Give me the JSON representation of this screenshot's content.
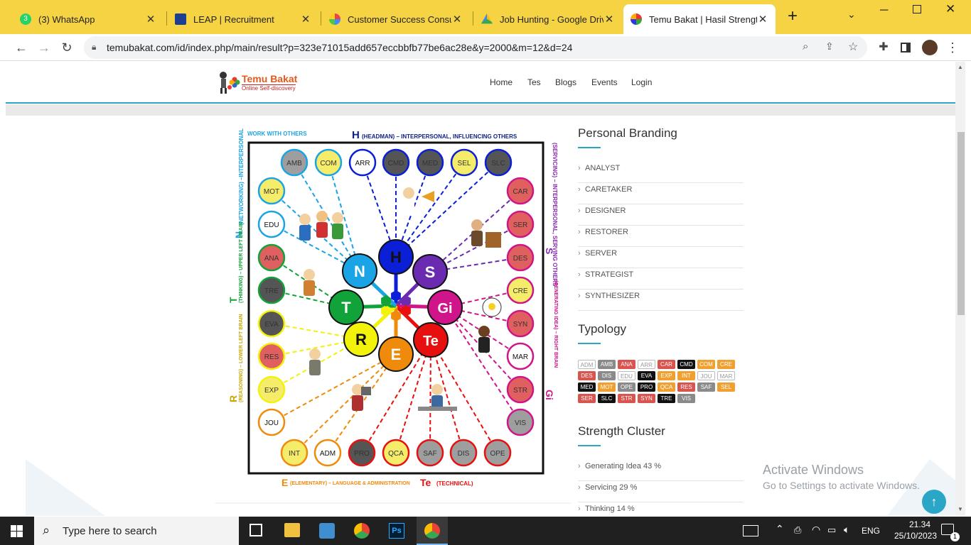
{
  "browser": {
    "tabs": [
      {
        "title": "(3) WhatsApp",
        "badge": "3"
      },
      {
        "title": "LEAP | Recruitment"
      },
      {
        "title": "Customer Success Consulta"
      },
      {
        "title": "Job Hunting - Google Drive"
      },
      {
        "title": "Temu Bakat | Hasil Strength"
      }
    ],
    "new_tab": "+",
    "url": "temubakat.com/id/index.php/main/result?p=323e71015add657eccbbfb77be6ac28e&y=2000&m=12&d=24"
  },
  "site": {
    "logo_title": "Temu Bakat",
    "logo_subtitle": "Online Self-discovery",
    "nav": [
      "Home",
      "Tes",
      "Blogs",
      "Events",
      "Login"
    ]
  },
  "diagram": {
    "top_header": "(HEADMAN) – INTERPERSONAL, INFLUENCING OTHERS",
    "top_letter": "H",
    "work_with_others": "WORK WITH OTHERS",
    "left_n_label": "(NETWORKING) –INTERPERSONAL",
    "left_n_letter": "N",
    "left_t_label": "(THINKING) – UPPER LEFT BRAIN",
    "left_t_letter": "T",
    "left_r_label": "(REASONING) – LOWER LEFT BRAIN",
    "left_r_letter": "R",
    "right_s_label": "(SERVICING) – INTERPERSONAL, SERVING OTHERS",
    "right_s_letter": "S",
    "right_gi_label": "(GENERATING IDEA) – RIGHT BRAIN",
    "right_gi_letter": "Gi",
    "bottom_e_letter": "E",
    "bottom_e_label": "(ELEMENTARY) – LANGUAGE & ADMINISTRATION",
    "bottom_te_letter": "Te",
    "bottom_te_label": "(TECHNICAL)",
    "hubs": [
      "H",
      "S",
      "Gi",
      "Te",
      "E",
      "R",
      "T",
      "N"
    ],
    "nodes": [
      "AMB",
      "COM",
      "ARR",
      "CMD",
      "MED",
      "SEL",
      "SLC",
      "CAR",
      "SER",
      "DES",
      "CRE",
      "SYN",
      "MAR",
      "STR",
      "VIS",
      "OPE",
      "DIS",
      "SAF",
      "QCA",
      "PRO",
      "ADM",
      "INT",
      "JOU",
      "EXP",
      "RES",
      "EVA",
      "TRE",
      "ANA",
      "EDU",
      "MOT"
    ]
  },
  "sidebar": {
    "personal_branding_title": "Personal Branding",
    "personal_branding": [
      "ANALYST",
      "CARETAKER",
      "DESIGNER",
      "RESTORER",
      "SERVER",
      "STRATEGIST",
      "SYNTHESIZER"
    ],
    "typology_title": "Typology",
    "typology": [
      [
        "ADM",
        "AMB",
        "ANA",
        "ARR",
        "CAR",
        "CMD",
        "COM",
        "CRE"
      ],
      [
        "DES",
        "DIS",
        "EDU",
        "EVA",
        "EXP",
        "INT",
        "JOU",
        "MAR"
      ],
      [
        "MED",
        "MOT",
        "OPE",
        "PRO",
        "QCA",
        "RES",
        "SAF",
        "SEL"
      ],
      [
        "SER",
        "SLC",
        "STR",
        "SYN",
        "TRE",
        "VIS"
      ]
    ],
    "strength_cluster_title": "Strength Cluster",
    "strength_cluster": [
      "Generating Idea 43 %",
      "Servicing 29 %",
      "Thinking 14 %"
    ]
  },
  "watermark": {
    "line1": "Activate Windows",
    "line2": "Go to Settings to activate Windows."
  },
  "taskbar": {
    "search_placeholder": "Type here to search",
    "language": "ENG",
    "time": "21.34",
    "date": "25/10/2023",
    "notification_count": "1"
  },
  "colors": {
    "tab_strip": "#f5d343",
    "accent": "#2aa6c6",
    "red": "#d9534f",
    "black": "#111111",
    "gray": "#8a8a8a",
    "orange": "#f0a030"
  }
}
